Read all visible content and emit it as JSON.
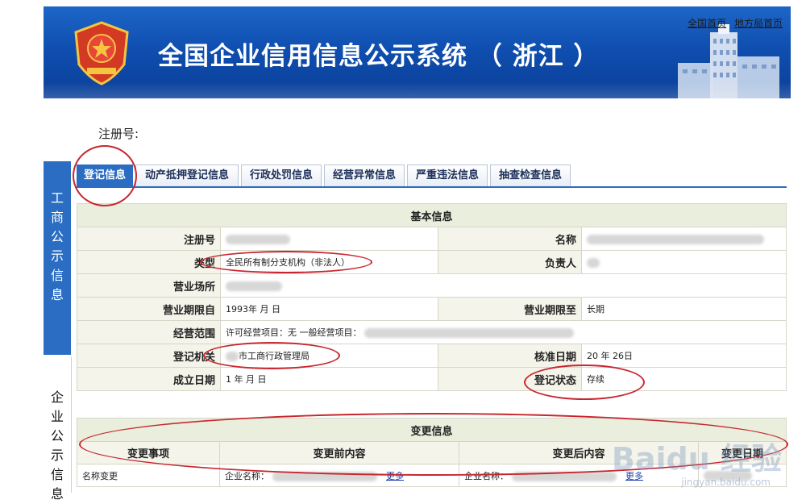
{
  "header": {
    "title": "全国企业信用信息公示系统 （ 浙江 ）",
    "links": [
      "全国首页",
      "地方局首页"
    ]
  },
  "registration_label": "注册号:",
  "side_nav": [
    "工商公示信息",
    "企业公示信息"
  ],
  "tabs": [
    "登记信息",
    "动产抵押登记信息",
    "行政处罚信息",
    "经营异常信息",
    "严重违法信息",
    "抽查检查信息"
  ],
  "basic_info": {
    "title": "基本信息",
    "fields": {
      "reg_no": "注册号",
      "name": "名称",
      "type": "类型",
      "type_value": "全民所有制分支机构（非法人）",
      "person": "负责人",
      "address": "营业场所",
      "term_from": "营业期限自",
      "term_from_value": "1993年  月  日",
      "term_to": "营业期限至",
      "term_to_value": "长期",
      "scope": "经营范围",
      "scope_value": "许可经营项目：无   一般经营项目：",
      "authority": "登记机关",
      "authority_value": "市工商行政管理局",
      "approval_date": "核准日期",
      "approval_date_value": "20    年    26日",
      "established": "成立日期",
      "established_value": "1    年    月   日",
      "status": "登记状态",
      "status_value": "存续"
    }
  },
  "change_info": {
    "title": "变更信息",
    "columns": [
      "变更事项",
      "变更前内容",
      "变更后内容",
      "变更日期"
    ],
    "rows": [
      {
        "item": "名称变更",
        "before": "企业名称：",
        "after": "企业名称：",
        "more": "更多"
      }
    ]
  },
  "watermark": {
    "main": "Baidu 经验",
    "sub": "jingyan.baidu.com"
  },
  "colors": {
    "header_blue": "#0f4fb0",
    "tab_active": "#2a6dc2",
    "annotation_red": "#c8262e",
    "label_bg": "#f4f4ea",
    "section_bg": "#eaeedd"
  }
}
